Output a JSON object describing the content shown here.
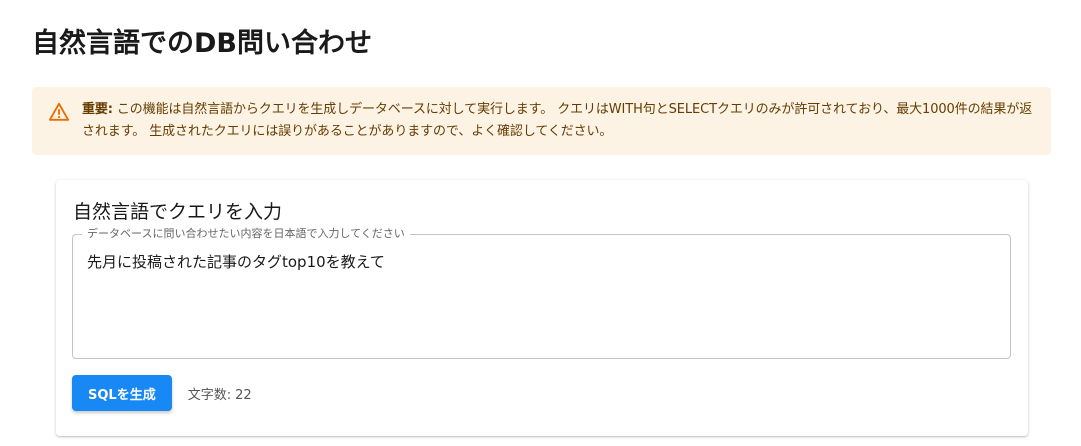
{
  "page": {
    "title": "自然言語でのDB問い合わせ"
  },
  "alert": {
    "icon": "warning-triangle-icon",
    "color": "#ed6c02",
    "background": "#fdf3e5",
    "strong": "重要:",
    "message": "この機能は自然言語からクエリを生成しデータベースに対して実行します。 クエリはWITH句とSELECTクエリのみが許可されており、最大1000件の結果が返されます。 生成されたクエリには誤りがあることがありますので、よく確認してください。"
  },
  "query_card": {
    "title": "自然言語でクエリを入力",
    "input_label": "データベースに問い合わせたい内容を日本語で入力してください",
    "input_value": "先月に投稿された記事のタグtop10を教えて",
    "generate_button": "SQLを生成",
    "button_color": "#1888f4",
    "char_count_label": "文字数:",
    "char_count": "22"
  }
}
